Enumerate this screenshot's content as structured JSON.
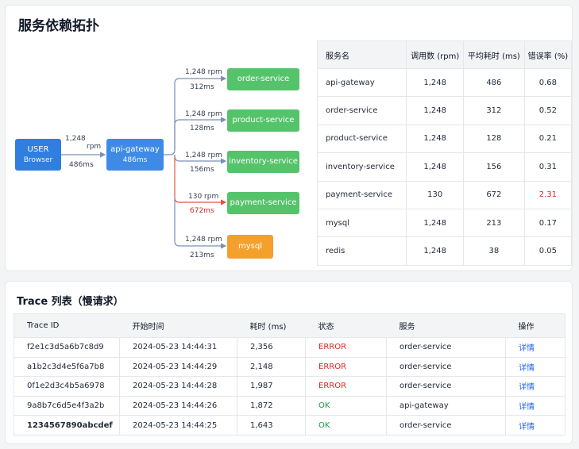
{
  "topology": {
    "title": "服务依赖拓扑",
    "user_node": {
      "label": "USER",
      "sub": "Browser"
    },
    "gateway_node": {
      "label": "api-gateway",
      "sub": "486ms"
    },
    "user_edge": {
      "rpm": "1,248",
      "rpm_unit": "rpm",
      "latency": "486ms"
    },
    "services": [
      {
        "name": "order-service",
        "rpm": "1,248 rpm",
        "latency": "312ms",
        "error": false
      },
      {
        "name": "product-service",
        "rpm": "1,248 rpm",
        "latency": "128ms",
        "error": false
      },
      {
        "name": "inventory-service",
        "rpm": "1,248 rpm",
        "latency": "156ms",
        "error": false
      },
      {
        "name": "payment-service",
        "rpm": "130 rpm",
        "latency": "672ms",
        "error": true
      },
      {
        "name": "mysql",
        "rpm": "1,248 rpm",
        "latency": "213ms",
        "error": false
      }
    ],
    "colors": {
      "node_blue": "#2f7ee0",
      "service_green": "#55c36a",
      "db_orange": "#f5a02c",
      "edge": "#7b8fb5",
      "error_edge": "#e5533d"
    }
  },
  "service_table": {
    "headers": [
      "服务名",
      "调用数 (rpm)",
      "平均耗时 (ms)",
      "错误率 (%)"
    ],
    "rows": [
      {
        "name": "api-gateway",
        "calls": "1,248",
        "avg": "486",
        "err": "0.68",
        "err_high": false
      },
      {
        "name": "order-service",
        "calls": "1,248",
        "avg": "312",
        "err": "0.52",
        "err_high": false
      },
      {
        "name": "product-service",
        "calls": "1,248",
        "avg": "128",
        "err": "0.21",
        "err_high": false
      },
      {
        "name": "inventory-service",
        "calls": "1,248",
        "avg": "156",
        "err": "0.31",
        "err_high": false
      },
      {
        "name": "payment-service",
        "calls": "130",
        "avg": "672",
        "err": "2.31",
        "err_high": true
      },
      {
        "name": "mysql",
        "calls": "1,248",
        "avg": "213",
        "err": "0.17",
        "err_high": false
      },
      {
        "name": "redis",
        "calls": "1,248",
        "avg": "38",
        "err": "0.05",
        "err_high": false
      }
    ]
  },
  "trace_list": {
    "title": "Trace 列表（慢请求）",
    "headers": [
      "Trace ID",
      "开始时间",
      "耗时 (ms)",
      "状态",
      "服务",
      "操作"
    ],
    "rows": [
      {
        "id": "f2e1c3d5a6b7c8d9",
        "start": "2024-05-23 14:44:31",
        "duration": "2,356",
        "status": "ERROR",
        "service": "order-service",
        "action": "详情"
      },
      {
        "id": "a1b2c3d4e5f6a7b8",
        "start": "2024-05-23 14:44:29",
        "duration": "2,148",
        "status": "ERROR",
        "service": "order-service",
        "action": "详情"
      },
      {
        "id": "0f1e2d3c4b5a6978",
        "start": "2024-05-23 14:44:28",
        "duration": "1,987",
        "status": "ERROR",
        "service": "order-service",
        "action": "详情"
      },
      {
        "id": "9a8b7c6d5e4f3a2b",
        "start": "2024-05-23 14:44:26",
        "duration": "1,872",
        "status": "OK",
        "service": "api-gateway",
        "action": "详情"
      },
      {
        "id": "1234567890abcdef",
        "start": "2024-05-23 14:44:25",
        "duration": "1,643",
        "status": "OK",
        "service": "order-service",
        "action": "详情"
      }
    ]
  }
}
